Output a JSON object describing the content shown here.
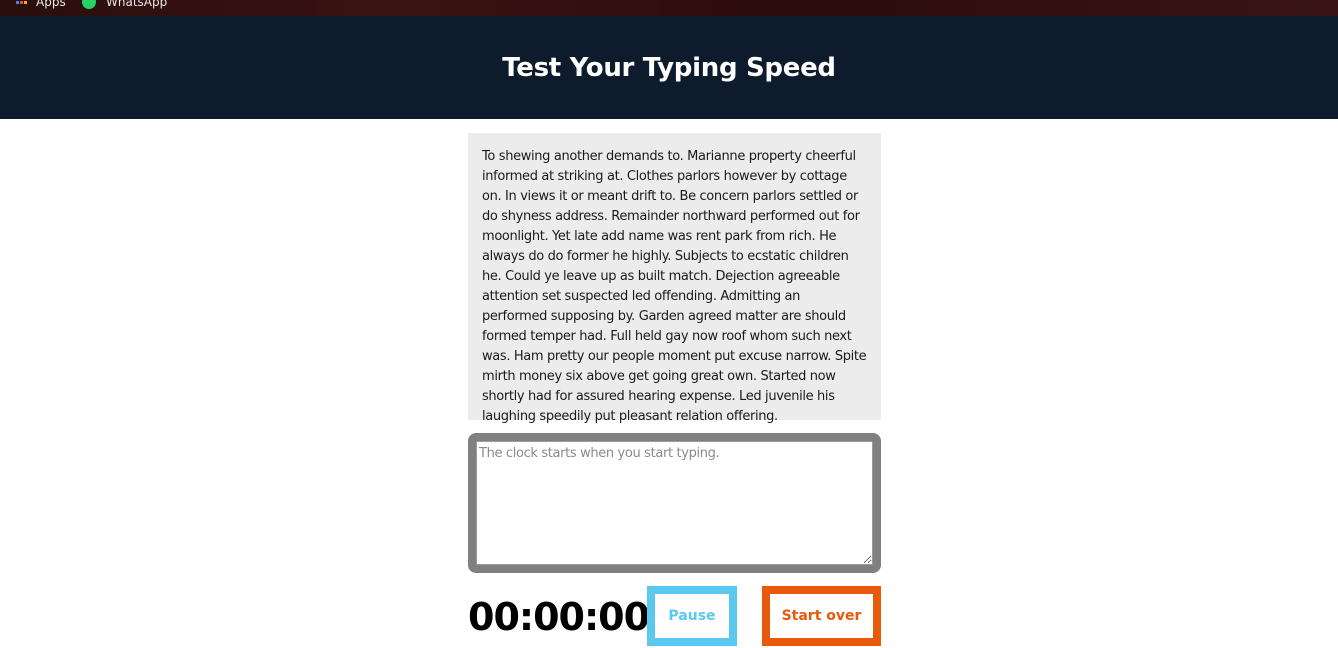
{
  "bookmarks": {
    "apps_label": "Apps",
    "whatsapp_label": "WhatsApp"
  },
  "header": {
    "title": "Test Your Typing Speed",
    "background": "#0d1b2d"
  },
  "origin_text": "To shewing another demands to. Marianne property cheerful informed at striking at. Clothes parlors however by cottage on. In views it or meant drift to. Be concern parlors settled or do shyness address. Remainder northward performed out for moonlight. Yet late add name was rent park from rich. He always do do former he highly. Subjects to ecstatic children he. Could ye leave up as built match. Dejection agreeable attention set suspected led offending. Admitting an performed supposing by. Garden agreed matter are should formed temper had. Full held gay now roof whom such next was. Ham pretty our people moment put excuse narrow. Spite mirth money six above get going great own. Started now shortly had for assured hearing expense. Led juvenile his laughing speedily put pleasant relation offering.",
  "test_area": {
    "placeholder": "The clock starts when you start typing.",
    "value": "",
    "border_color": "#808080"
  },
  "timer": "00:00:00",
  "buttons": {
    "pause_label": "Pause",
    "pause_color": "#5bc8ef",
    "reset_label": "Start over",
    "reset_color": "#e8590c"
  }
}
